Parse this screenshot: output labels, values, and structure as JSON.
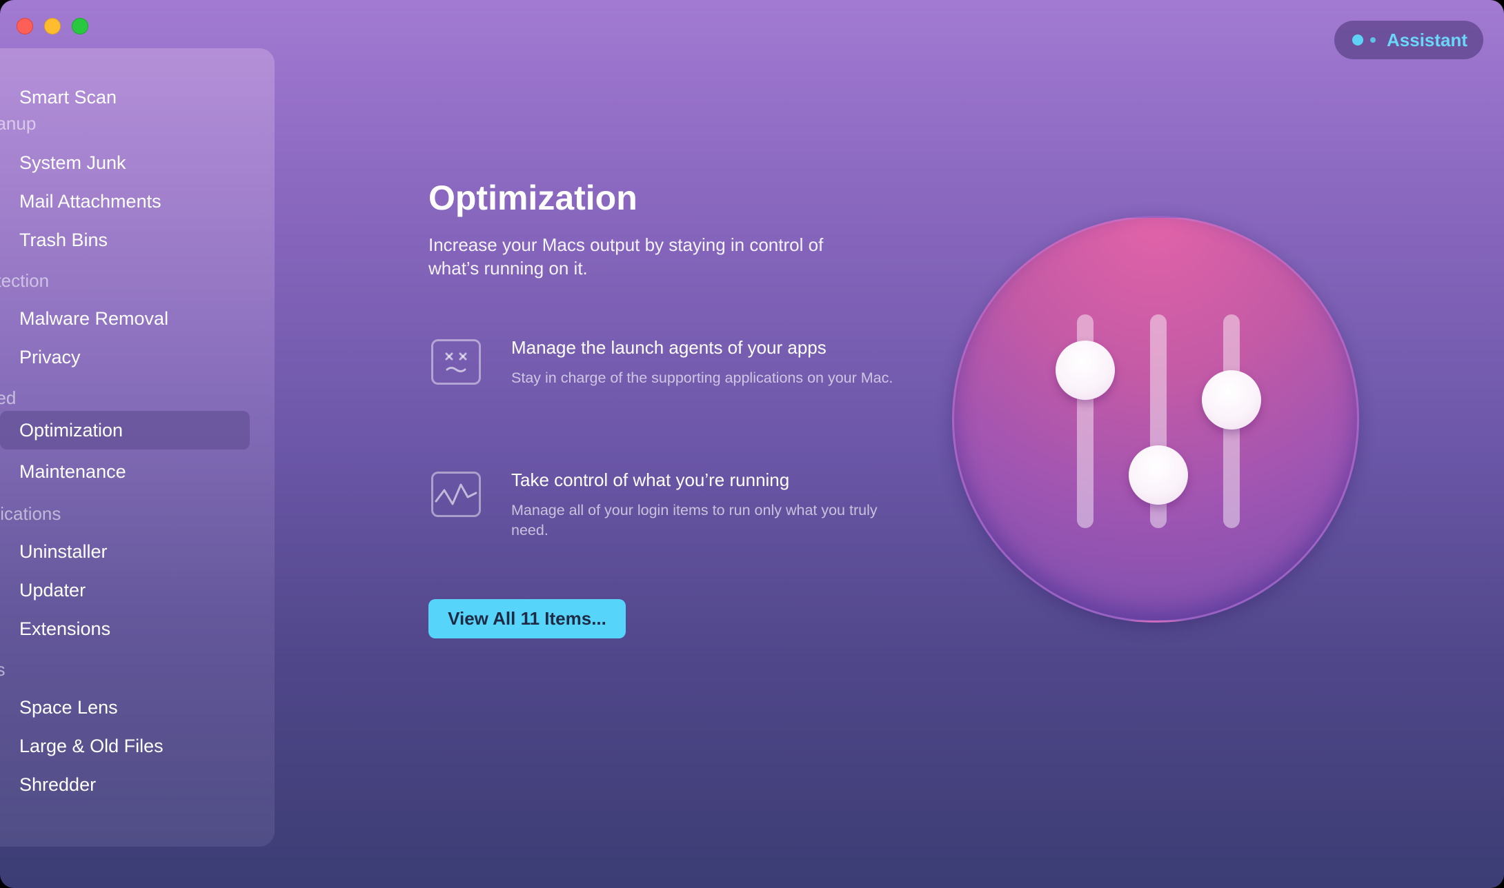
{
  "window": {
    "controls": {
      "close": "close",
      "minimize": "minimize",
      "zoom": "zoom"
    }
  },
  "assistant": {
    "label": "Assistant"
  },
  "sidebar": {
    "items": [
      {
        "label": "Smart Scan",
        "icon": "smart-scan-icon"
      },
      {
        "label": "System Junk",
        "icon": "system-junk-icon"
      },
      {
        "label": "Mail Attachments",
        "icon": "mail-attachments-icon"
      },
      {
        "label": "Trash Bins",
        "icon": "trash-bins-icon"
      },
      {
        "label": "Malware Removal",
        "icon": "malware-removal-icon"
      },
      {
        "label": "Privacy",
        "icon": "privacy-icon"
      },
      {
        "label": "Optimization",
        "icon": "optimization-icon",
        "active": true
      },
      {
        "label": "Maintenance",
        "icon": "maintenance-icon"
      },
      {
        "label": "Uninstaller",
        "icon": "uninstaller-icon"
      },
      {
        "label": "Updater",
        "icon": "updater-icon"
      },
      {
        "label": "Extensions",
        "icon": "extensions-icon"
      },
      {
        "label": "Space Lens",
        "icon": "space-lens-icon"
      },
      {
        "label": "Large & Old Files",
        "icon": "large-old-files-icon"
      },
      {
        "label": "Shredder",
        "icon": "shredder-icon"
      }
    ],
    "sections": {
      "cleanup": "eanup",
      "protection": "otection",
      "speed": "eed",
      "applications": "plications",
      "files": "es"
    }
  },
  "main": {
    "title": "Optimization",
    "subtitle": "Increase your Macs output by staying in control of what’s running on it.",
    "features": [
      {
        "title": "Manage the launch agents of your apps",
        "description": "Stay in charge of the supporting applications on your Mac.",
        "icon": "dizzy-face-icon"
      },
      {
        "title": "Take control of what you’re running",
        "description": "Manage all of your login items to run only what you truly need.",
        "icon": "waveform-icon"
      }
    ],
    "view_button": "View All 11 Items...",
    "hero_icon": "sliders-icon",
    "sliders": [
      0.26,
      0.75,
      0.4
    ]
  },
  "colors": {
    "accent": "#57d4fa",
    "assistant_text": "#6ad6f8",
    "close": "#fe5f57",
    "minimize": "#febc2e",
    "zoom": "#28c840"
  }
}
